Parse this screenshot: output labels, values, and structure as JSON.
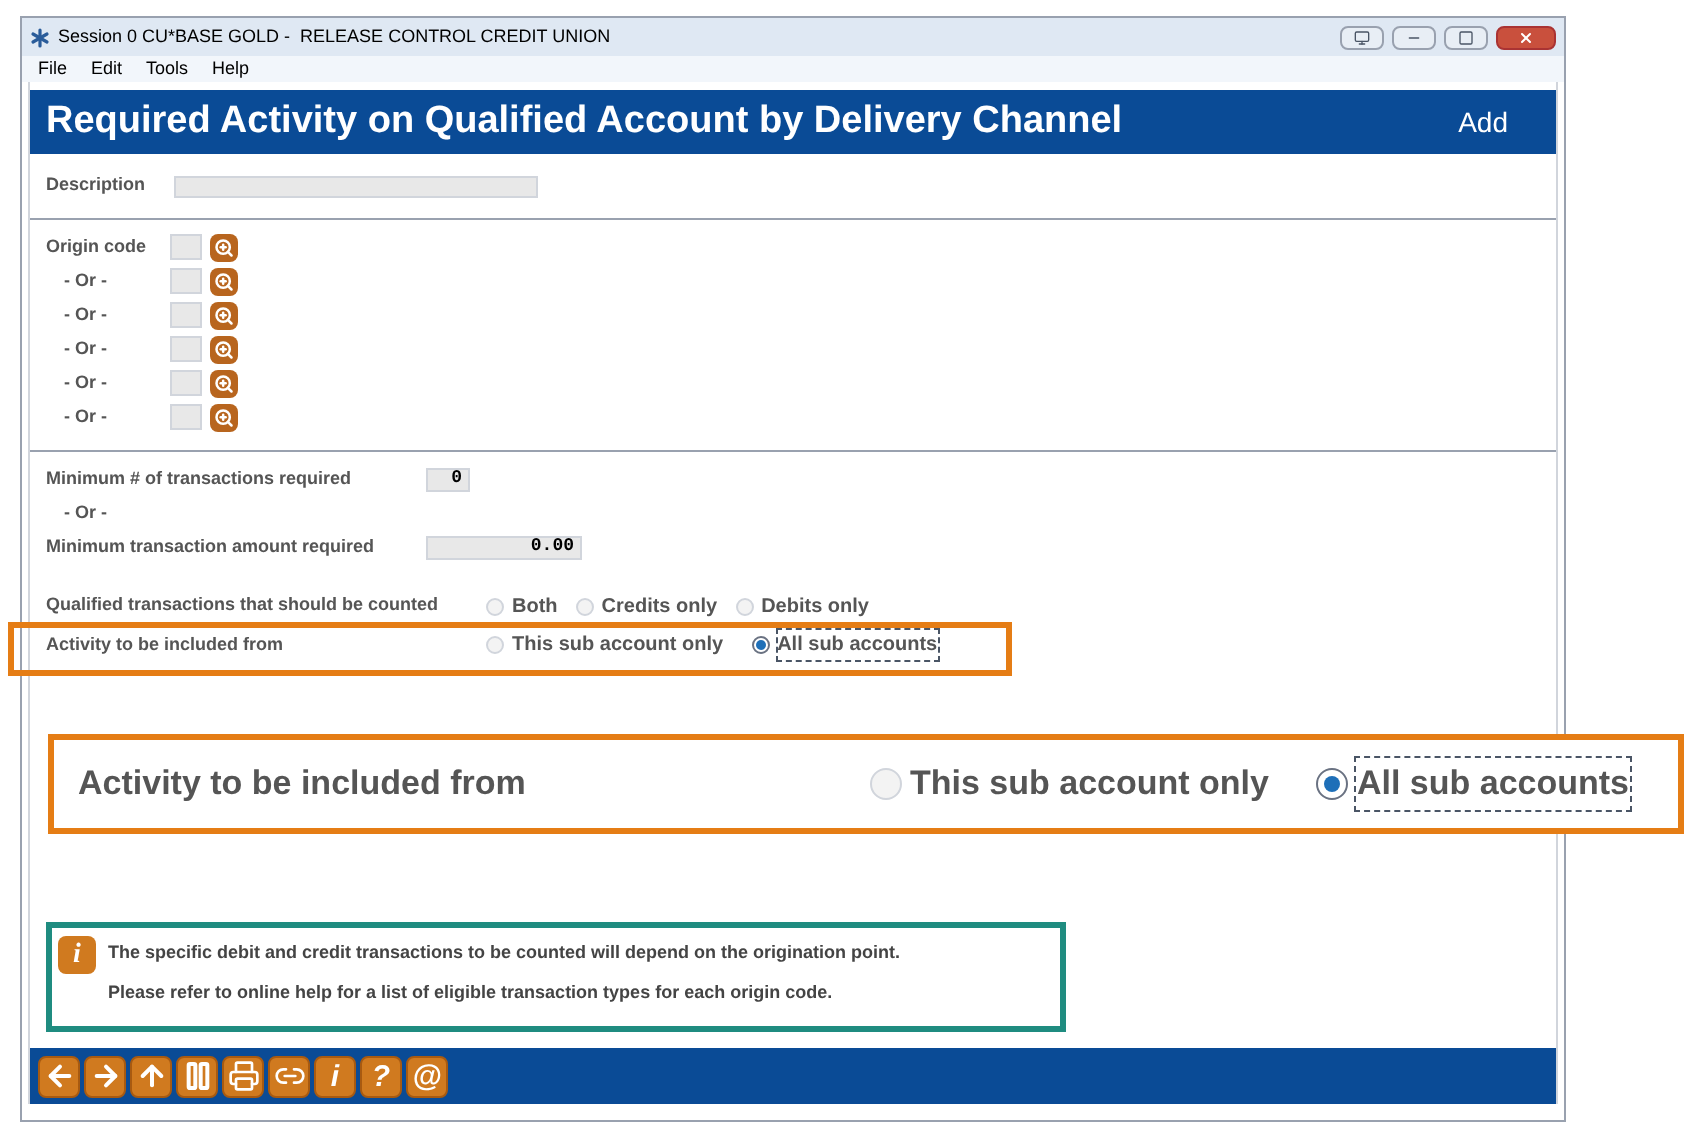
{
  "window": {
    "title": "Session 0 CU*BASE GOLD -  RELEASE CONTROL CREDIT UNION"
  },
  "menu": [
    "File",
    "Edit",
    "Tools",
    "Help"
  ],
  "header": {
    "title": "Required Activity on Qualified Account by Delivery Channel",
    "mode": "Add"
  },
  "description": {
    "label": "Description"
  },
  "origin_codes": [
    {
      "label": "Origin code"
    },
    {
      "label": "- Or -"
    },
    {
      "label": "- Or -"
    },
    {
      "label": "- Or -"
    },
    {
      "label": "- Or -"
    },
    {
      "label": "- Or -"
    }
  ],
  "minimums": {
    "count_label": "Minimum # of transactions required",
    "count_value": "0",
    "or_label": "- Or -",
    "amount_label": "Minimum transaction amount required",
    "amount_value": "0.00"
  },
  "qualified": {
    "label": "Qualified transactions that should be counted",
    "options": [
      {
        "label": "Both",
        "selected": false
      },
      {
        "label": "Credits only",
        "selected": false
      },
      {
        "label": "Debits only",
        "selected": false
      }
    ]
  },
  "activity": {
    "label": "Activity to be included from",
    "options": [
      {
        "label": "This sub account only",
        "selected": false
      },
      {
        "label": "All sub accounts",
        "selected": true
      }
    ]
  },
  "callout": {
    "label": "Activity to be included from",
    "options": [
      {
        "label": "This sub account only",
        "selected": false
      },
      {
        "label": "All sub accounts",
        "selected": true
      }
    ]
  },
  "info": {
    "icon": "i",
    "lines": [
      "The specific debit and credit transactions to be counted will depend on the origination point.",
      "Please refer to online help for a list of eligible transaction types for each origin code."
    ]
  },
  "toolbar": [
    {
      "kind": "back"
    },
    {
      "kind": "forward"
    },
    {
      "kind": "up"
    },
    {
      "kind": "pause"
    },
    {
      "kind": "print"
    },
    {
      "kind": "link"
    },
    {
      "kind": "glyph",
      "label": "i"
    },
    {
      "kind": "glyph",
      "label": "?"
    },
    {
      "kind": "glyph",
      "label": "@"
    }
  ]
}
